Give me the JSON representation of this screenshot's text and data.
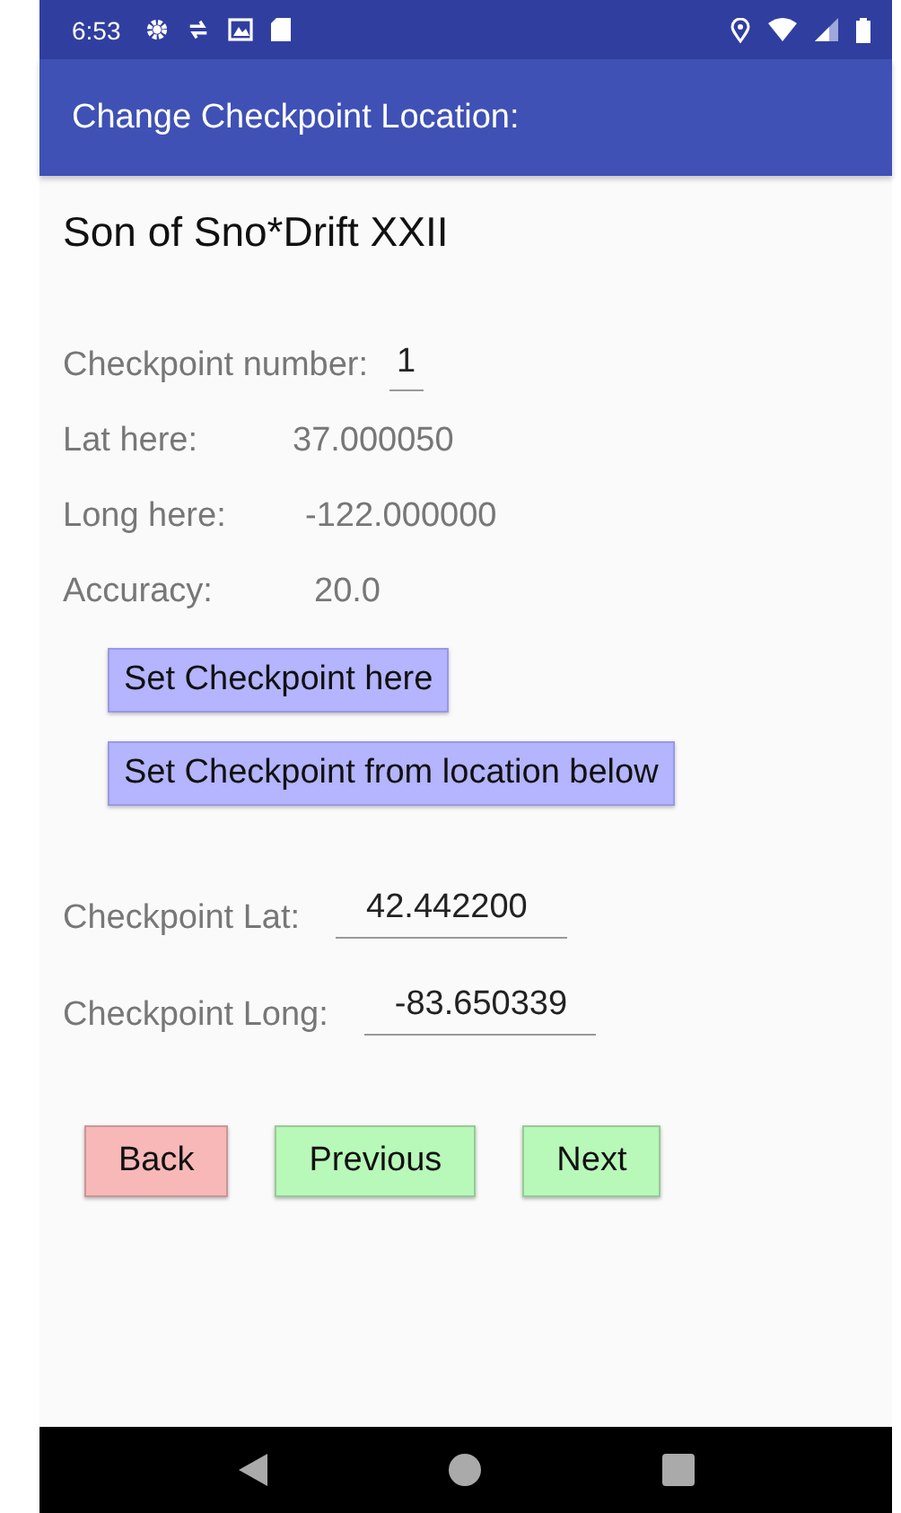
{
  "status_bar": {
    "time": "6:53"
  },
  "app_bar": {
    "title": "Change Checkpoint Location:"
  },
  "event_name": "Son of Sno*Drift XXII",
  "checkpoint_number": {
    "label": "Checkpoint number:",
    "value": "1"
  },
  "readings": [
    {
      "label": "Lat here:",
      "value": "37.000050"
    },
    {
      "label": "Long here:",
      "value": "-122.000000"
    },
    {
      "label": "Accuracy:",
      "value": "20.0"
    }
  ],
  "set_buttons": [
    "Set Checkpoint here",
    "Set Checkpoint from location below"
  ],
  "fields": [
    {
      "label": "Checkpoint Lat:",
      "value": "42.442200"
    },
    {
      "label": "Checkpoint Long:",
      "value": "-83.650339"
    }
  ],
  "nav_buttons": [
    {
      "label": "Back",
      "color": "#f8b8b8"
    },
    {
      "label": "Previous",
      "color": "#b8f8b8"
    },
    {
      "label": "Next",
      "color": "#b8f8b8"
    }
  ]
}
